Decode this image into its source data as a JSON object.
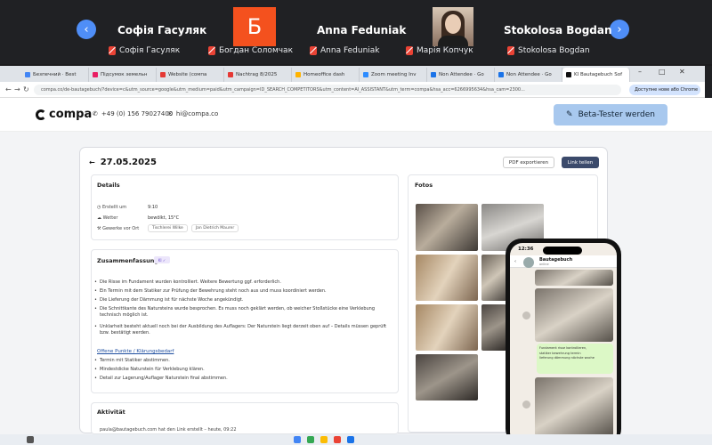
{
  "meet": {
    "participants": [
      {
        "name": "Софія Гасуляк",
        "label": "Софія Гасуляк"
      },
      {
        "name": "",
        "initial": "Б",
        "label": "Богдан Соломчак"
      },
      {
        "name": "Anna Feduniak",
        "label": "Anna Feduniak"
      },
      {
        "name": "",
        "label": "Марія Копчук"
      },
      {
        "name": "Stokolosa Bogdan",
        "label": "Stokolosa Bogdan"
      }
    ],
    "prev_glyph": "‹",
    "next_glyph": "›",
    "accent": "#4f8ef7",
    "avatar_color": "#f4511e"
  },
  "browser": {
    "tabs": [
      {
        "label": "Безпечний · Best"
      },
      {
        "label": "Підсумок земельн"
      },
      {
        "label": "Website (сомпа"
      },
      {
        "label": "Nachtrag 8/2025"
      },
      {
        "label": "Homeoffice dash"
      },
      {
        "label": "Zoom meeting Inv"
      },
      {
        "label": "Non Attendee · Go"
      },
      {
        "label": "Non Attendee · Go"
      },
      {
        "label": "KI Bautagebuch Sof"
      }
    ],
    "url": "compa.co/de-bautagebuch/?device=c&utm_source=google&utm_medium=paid&utm_campaign=ID_SEARCH_COMPETITORS&utm_content=AI_ASSISTANT&utm_term=compa&hsa_acc=6266995634&hsa_cam=2300...",
    "ext_label": "Доступне нове або Chrome"
  },
  "site": {
    "logo": "compa",
    "phone": "+49 (0) 156 79027400",
    "email": "hi@compa.co",
    "beta_button": "Beta-Tester werden"
  },
  "report": {
    "date": "27.05.2025",
    "pdf_button": "PDF exportieren",
    "share_button": "Link teilen",
    "details": {
      "heading": "Details",
      "rows": [
        {
          "label": "Erstellt um",
          "value": "9:10"
        },
        {
          "label": "Wetter",
          "value": "bewölkt, 15°C"
        },
        {
          "label": "Gewerke vor Ort",
          "chips": [
            "Tischlerei Wilke",
            "Jan Dietrich Maurer"
          ]
        }
      ]
    },
    "summary": {
      "heading": "Zusammenfassung",
      "tag": "KI ✓",
      "bullets": [
        "Die Risse im Fundament wurden kontrolliert. Weitere Bewertung ggf. erforderlich.",
        "Ein Termin mit dem Statiker zur Prüfung der Bewehrung steht noch aus und muss koordiniert werden.",
        "Die Lieferung der Dämmung ist für nächste Woche angekündigt.",
        "Die Schnittkante des Natursteins wurde besprochen. Es muss noch geklärt werden, ob weicher Stoßstücke eine Verklebung technisch möglich ist.",
        "Unklarheit besteht aktuell noch bei der Ausbildung des Auflagers: Der Naturstein liegt derzeit oben auf – Details müssen geprüft bzw. bestätigt werden."
      ],
      "open_heading": "Offene Punkte / Klärungsbedarf",
      "open_points": [
        "Termin mit Statiker abstimmen.",
        "Mindestdicke Naturstein für Verklebung klären.",
        "Detail zur Lagerung/Auflager Naturstein final abstimmen."
      ]
    },
    "activity": {
      "heading": "Aktivität",
      "entry": "paula@bautagebuch.com hat den Link erstellt – heute, 09:22"
    },
    "photos": {
      "heading": "Fotos"
    }
  },
  "phone": {
    "time": "12:36",
    "chat_title": "Bautagebuch",
    "chat_sub": "online",
    "message_lines": [
      "Fundament risse kontrollieren,",
      "statiker bewehrung termin",
      "lieferung dämmung nächste woche"
    ]
  }
}
